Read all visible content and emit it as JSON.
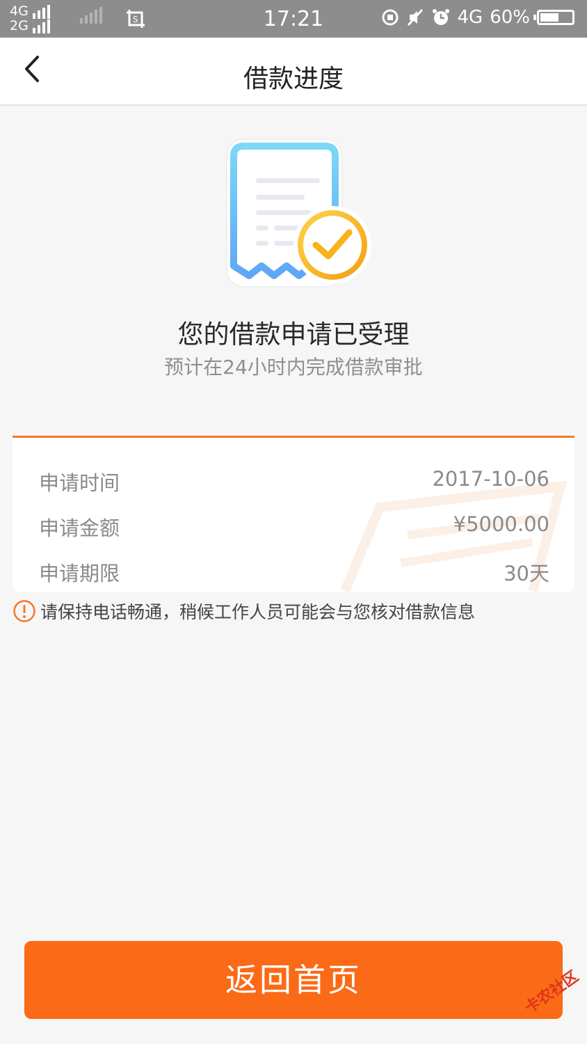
{
  "status_bar": {
    "net_top": "4G",
    "net_bottom": "2G",
    "time": "17:21",
    "net_right": "4G",
    "battery": "60%",
    "battery_level": 0.6
  },
  "nav": {
    "title": "借款进度"
  },
  "status": {
    "headline": "您的借款申请已受理",
    "subline": "预计在24小时内完成借款审批"
  },
  "details": [
    {
      "label": "申请时间",
      "value": "2017-10-06"
    },
    {
      "label": "申请金额",
      "value": "¥5000.00"
    },
    {
      "label": "申请期限",
      "value": "30天"
    }
  ],
  "notice": "请保持电话畅通，稍候工作人员可能会与您核对借款信息",
  "home_button": "返回首页",
  "watermark": "卡农社区",
  "colors": {
    "accent": "#fb6a16",
    "card_border": "#f5762a",
    "check": "#f9b21a",
    "doc_gradient_top": "#7cd8f7",
    "doc_gradient_bottom": "#5fa6f5"
  }
}
